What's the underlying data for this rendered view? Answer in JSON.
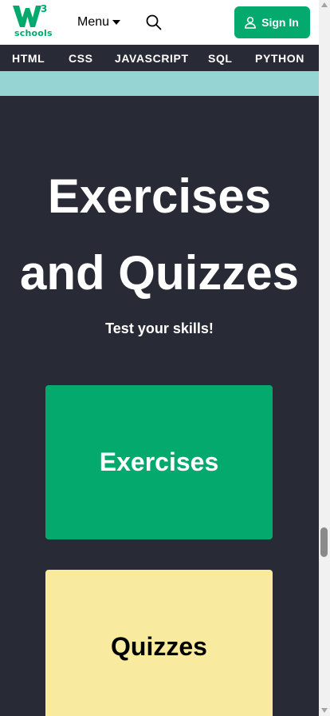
{
  "header": {
    "logo_superscript": "3",
    "logo_text": "schools",
    "menu_label": "Menu",
    "signin_label": "Sign In"
  },
  "nav": {
    "items": [
      "HTML",
      "CSS",
      "JAVASCRIPT",
      "SQL",
      "PYTHON"
    ]
  },
  "hero": {
    "title_line1": "Exercises",
    "title_line2": "and Quizzes",
    "subtitle": "Test your skills!"
  },
  "cards": {
    "exercises_label": "Exercises",
    "quizzes_label": "Quizzes"
  },
  "colors": {
    "brand_green": "#04aa6d",
    "dark_bg": "#282a35",
    "teal_strip": "#96d4d4",
    "quiz_yellow": "#f8eb9f"
  },
  "icons": {
    "search": "search-icon",
    "user": "user-icon",
    "menu_caret": "caret-down-icon"
  }
}
